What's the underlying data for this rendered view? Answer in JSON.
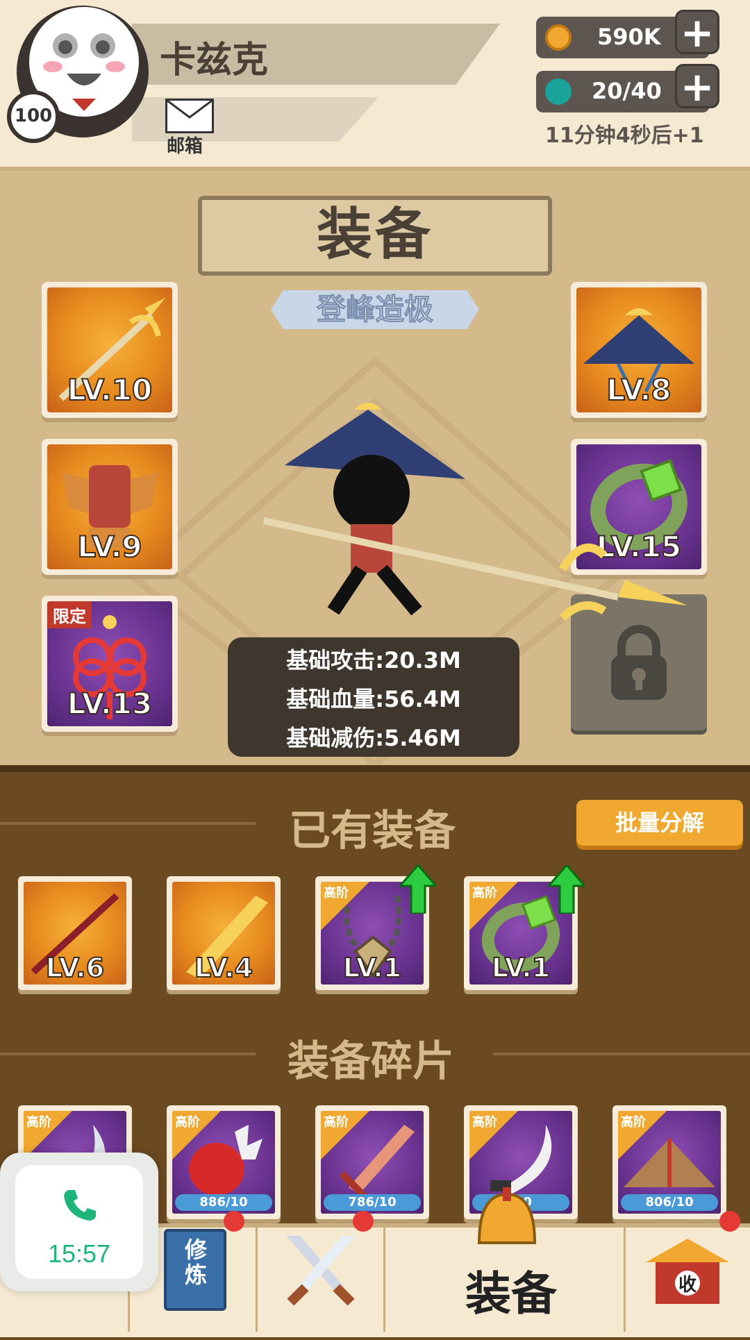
{
  "player": {
    "name": "卡兹克",
    "level": "100",
    "mail_label": "邮箱"
  },
  "resources": {
    "coins": "590K",
    "energy": "20/40",
    "energy_timer": "11分钟4秒后+1",
    "plus_symbol": "+"
  },
  "equipment_panel": {
    "title": "装备",
    "subtitle": "登峰造极",
    "slots": [
      {
        "name": "spear",
        "level": "LV.10",
        "rarity": "orange"
      },
      {
        "name": "armor",
        "level": "LV.9",
        "rarity": "orange"
      },
      {
        "name": "knot-charm",
        "level": "LV.13",
        "rarity": "purple",
        "tag": "限定"
      },
      {
        "name": "straw-hat",
        "level": "LV.8",
        "rarity": "orange"
      },
      {
        "name": "bracelet",
        "level": "LV.15",
        "rarity": "purple"
      }
    ],
    "stats": [
      "基础攻击:20.3M",
      "基础血量:56.4M",
      "基础减伤:5.46M"
    ]
  },
  "owned_equipment": {
    "title": "已有装备",
    "batch_button": "批量分解",
    "items": [
      {
        "name": "staff",
        "level": "LV.6",
        "rarity": "orange"
      },
      {
        "name": "broadsword",
        "level": "LV.4",
        "rarity": "orange"
      },
      {
        "name": "necklace",
        "level": "LV.1",
        "rarity": "purple",
        "tier": "高阶",
        "upgrade": true
      },
      {
        "name": "bracelet",
        "level": "LV.1",
        "rarity": "purple",
        "tier": "高阶",
        "upgrade": true
      }
    ]
  },
  "fragments": {
    "title": "装备碎片",
    "items": [
      {
        "name": "blade",
        "tier": "高阶",
        "count": ""
      },
      {
        "name": "gauntlet",
        "tier": "高阶",
        "count": "886/10"
      },
      {
        "name": "sword",
        "tier": "高阶",
        "count": "786/10"
      },
      {
        "name": "saber",
        "tier": "高阶",
        "count": "/10"
      },
      {
        "name": "hat",
        "tier": "高阶",
        "count": "806/10"
      }
    ]
  },
  "nav": {
    "cultivate_book_text": "修炼",
    "equipment_label": "装备",
    "collect_text": "收"
  },
  "call_widget": {
    "time": "15:57"
  },
  "colors": {
    "accent_orange": "#f0a830",
    "panel_brown": "#6b4a22",
    "rarity_orange": "#e78a1e",
    "rarity_purple": "#6a3390",
    "call_green": "#1fb47a",
    "badge_red": "#e53935"
  }
}
